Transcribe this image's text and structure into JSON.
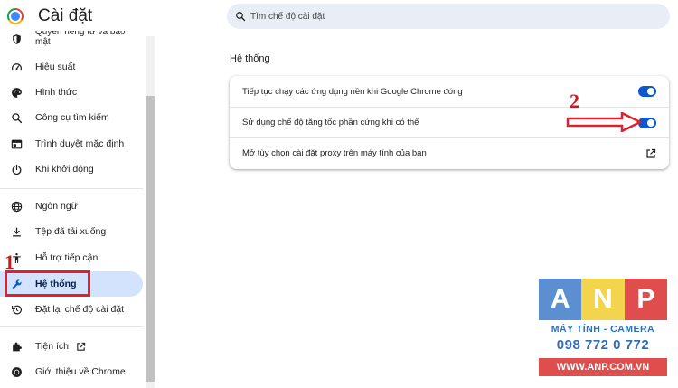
{
  "header": {
    "title": "Cài đặt",
    "search_placeholder": "Tìm chế độ cài đặt"
  },
  "sidebar": {
    "items": [
      {
        "label": "Quyền riêng tư và bảo mật",
        "icon": "shield-icon"
      },
      {
        "label": "Hiệu suất",
        "icon": "speedometer-icon"
      },
      {
        "label": "Hình thức",
        "icon": "palette-icon"
      },
      {
        "label": "Công cụ tìm kiếm",
        "icon": "search-icon"
      },
      {
        "label": "Trình duyệt mặc định",
        "icon": "browser-window-icon"
      },
      {
        "label": "Khi khởi động",
        "icon": "power-icon"
      },
      {
        "label": "Ngôn ngữ",
        "icon": "globe-icon"
      },
      {
        "label": "Tệp đã tải xuống",
        "icon": "download-icon"
      },
      {
        "label": "Hỗ trợ tiếp cận",
        "icon": "accessibility-icon"
      },
      {
        "label": "Hệ thống",
        "icon": "wrench-icon",
        "active": true
      },
      {
        "label": "Đặt lại chế độ cài đặt",
        "icon": "reset-history-icon"
      },
      {
        "label": "Tiện ích",
        "icon": "puzzle-icon"
      },
      {
        "label": "Giới thiệu về Chrome",
        "icon": "chrome-icon"
      }
    ]
  },
  "main": {
    "section_title": "Hệ thống",
    "settings": [
      {
        "label": "Tiếp tục chạy các ứng dụng nền khi Google Chrome đóng",
        "control": "toggle",
        "on": true
      },
      {
        "label": "Sử dụng chế độ tăng tốc phần cứng khi có thể",
        "control": "toggle",
        "on": true
      },
      {
        "label": "Mở tùy chọn cài đặt proxy trên máy tính của bạn",
        "control": "open-external"
      }
    ]
  },
  "annotations": {
    "marker_1": "1",
    "marker_2": "2"
  },
  "watermark": {
    "letters": [
      "A",
      "N",
      "P"
    ],
    "tagline": "MÁY TÍNH - CAMERA",
    "phone": "098 772 0 772",
    "url": "WWW.ANP.COM.VN"
  },
  "colors": {
    "accent": "#0b57d0",
    "active_nav_bg": "#d3e3fd",
    "search_bg": "#e9eef6",
    "annotation_red": "#e0202a"
  }
}
